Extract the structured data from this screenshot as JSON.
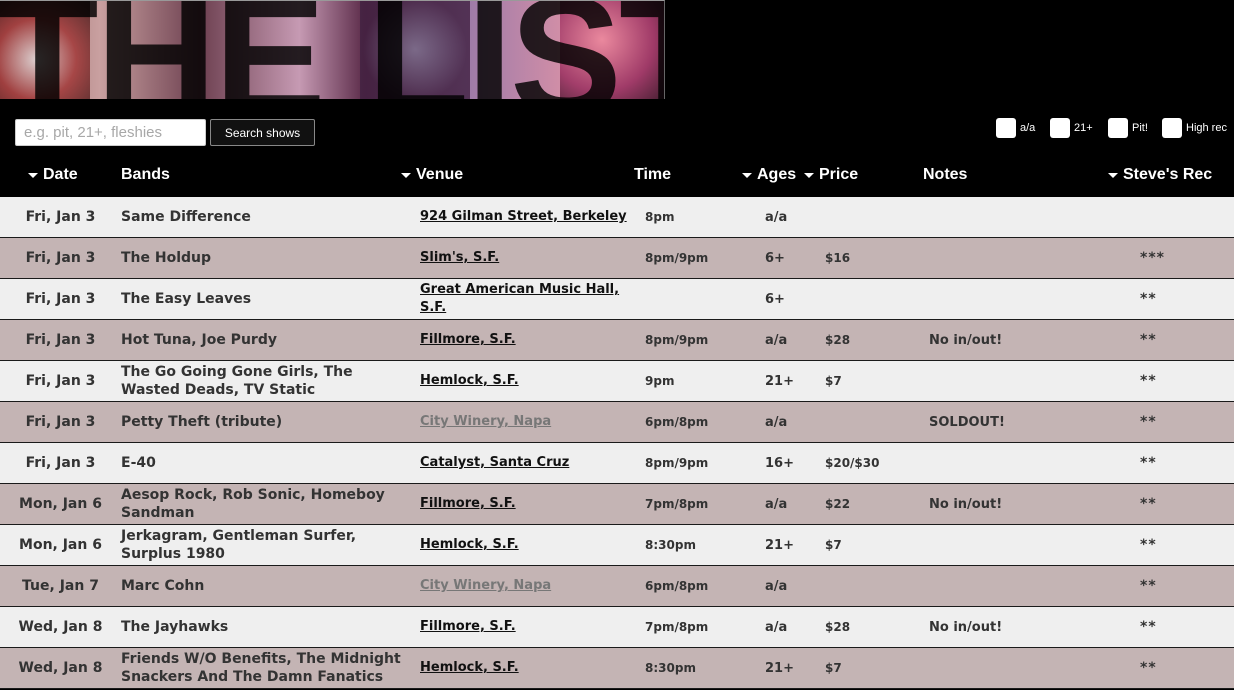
{
  "banner": {
    "title": "THE LIST"
  },
  "search": {
    "placeholder": "e.g. pit, 21+, fleshies",
    "button_label": "Search shows"
  },
  "filters": [
    {
      "label": "a/a"
    },
    {
      "label": "21+"
    },
    {
      "label": "Pit!"
    },
    {
      "label": "High rec"
    }
  ],
  "columns": {
    "date": "Date",
    "bands": "Bands",
    "venue": "Venue",
    "time": "Time",
    "ages": "Ages",
    "price": "Price",
    "notes": "Notes",
    "rec": "Steve's Rec"
  },
  "rows": [
    {
      "date": "Fri, Jan 3",
      "bands": "Same Difference",
      "venue": "924 Gilman Street, Berkeley",
      "venue_muted": false,
      "time": "8pm",
      "ages": "a/a",
      "price": "",
      "notes": "",
      "rec": ""
    },
    {
      "date": "Fri, Jan 3",
      "bands": "The Holdup",
      "venue": "Slim's, S.F.",
      "venue_muted": false,
      "time": "8pm/9pm",
      "ages": "6+",
      "price": "$16",
      "notes": "",
      "rec": "***"
    },
    {
      "date": "Fri, Jan 3",
      "bands": "The Easy Leaves",
      "venue": "Great American Music Hall, S.F.",
      "venue_muted": false,
      "time": "",
      "ages": "6+",
      "price": "",
      "notes": "",
      "rec": "**"
    },
    {
      "date": "Fri, Jan 3",
      "bands": "Hot Tuna, Joe Purdy",
      "venue": "Fillmore, S.F.",
      "venue_muted": false,
      "time": "8pm/9pm",
      "ages": "a/a",
      "price": "$28",
      "notes": "No in/out!",
      "rec": "**"
    },
    {
      "date": "Fri, Jan 3",
      "bands": "The Go Going Gone Girls, The Wasted Deads, TV Static",
      "venue": "Hemlock, S.F.",
      "venue_muted": false,
      "time": "9pm",
      "ages": "21+",
      "price": "$7",
      "notes": "",
      "rec": "**"
    },
    {
      "date": "Fri, Jan 3",
      "bands": "Petty Theft (tribute)",
      "venue": "City Winery, Napa",
      "venue_muted": true,
      "time": "6pm/8pm",
      "ages": "a/a",
      "price": "",
      "notes": "SOLDOUT!",
      "rec": "**"
    },
    {
      "date": "Fri, Jan 3",
      "bands": "E-40",
      "venue": "Catalyst, Santa Cruz",
      "venue_muted": false,
      "time": "8pm/9pm",
      "ages": "16+",
      "price": "$20/$30",
      "notes": "",
      "rec": "**"
    },
    {
      "date": "Mon, Jan 6",
      "bands": "Aesop Rock, Rob Sonic, Homeboy Sandman",
      "venue": "Fillmore, S.F.",
      "venue_muted": false,
      "time": "7pm/8pm",
      "ages": "a/a",
      "price": "$22",
      "notes": "No in/out!",
      "rec": "**"
    },
    {
      "date": "Mon, Jan 6",
      "bands": "Jerkagram, Gentleman Surfer, Surplus 1980",
      "venue": "Hemlock, S.F.",
      "venue_muted": false,
      "time": "8:30pm",
      "ages": "21+",
      "price": "$7",
      "notes": "",
      "rec": "**"
    },
    {
      "date": "Tue, Jan 7",
      "bands": "Marc Cohn",
      "venue": "City Winery, Napa",
      "venue_muted": true,
      "time": "6pm/8pm",
      "ages": "a/a",
      "price": "",
      "notes": "",
      "rec": "**"
    },
    {
      "date": "Wed, Jan 8",
      "bands": "The Jayhawks",
      "venue": "Fillmore, S.F.",
      "venue_muted": false,
      "time": "7pm/8pm",
      "ages": "a/a",
      "price": "$28",
      "notes": "No in/out!",
      "rec": "**"
    },
    {
      "date": "Wed, Jan 8",
      "bands": "Friends W/O Benefits, The Midnight Snackers And The Damn Fanatics",
      "venue": "Hemlock, S.F.",
      "venue_muted": false,
      "time": "8:30pm",
      "ages": "21+",
      "price": "$7",
      "notes": "",
      "rec": "**"
    }
  ]
}
